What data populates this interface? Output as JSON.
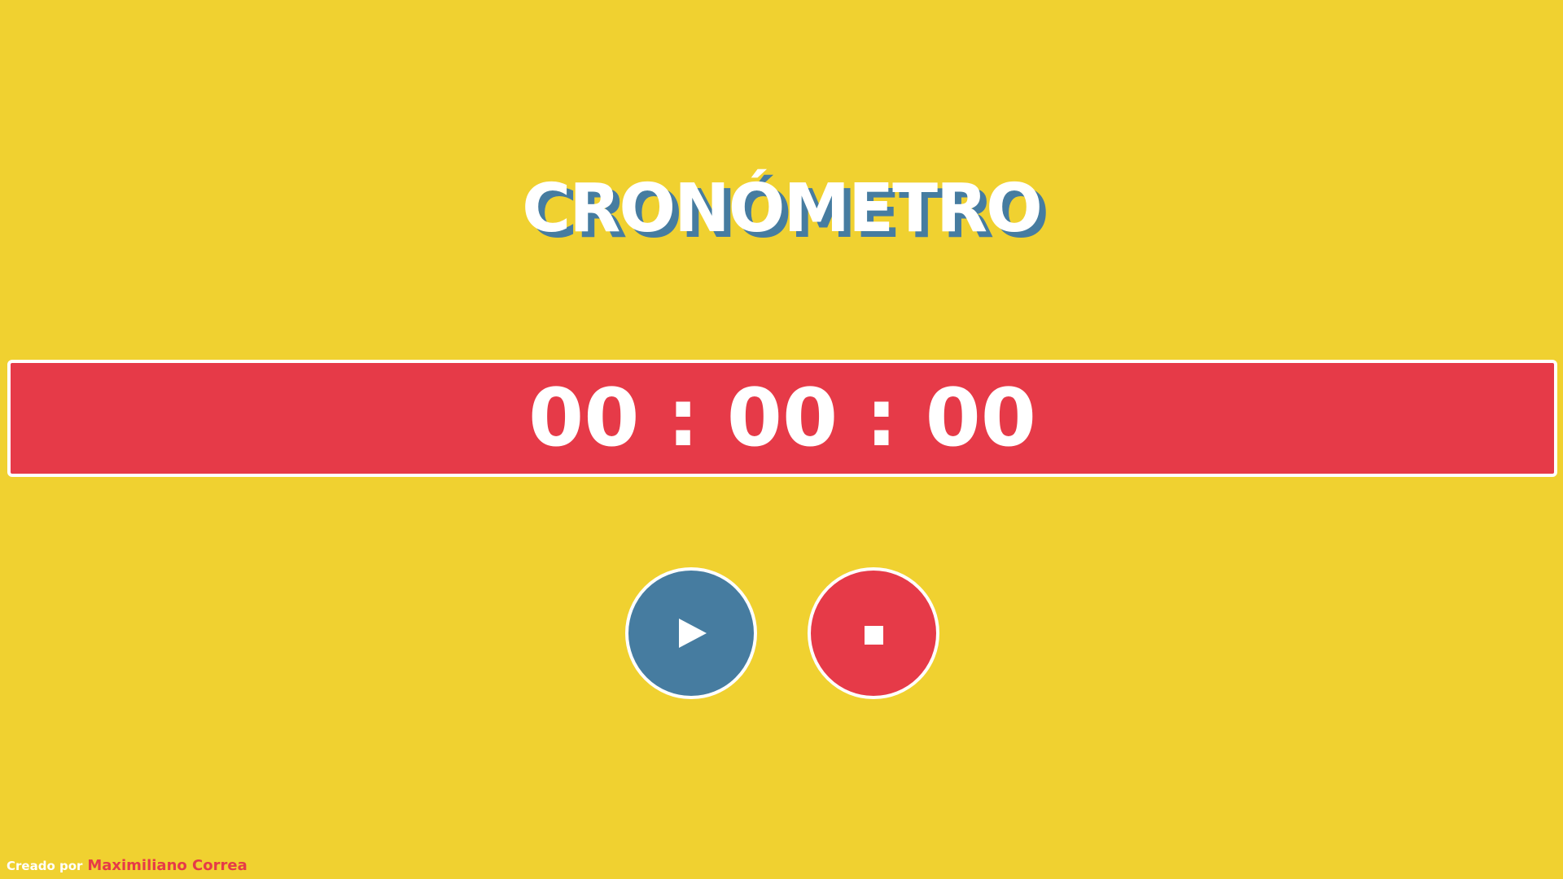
{
  "app": {
    "title": "CRONÓMETRO"
  },
  "timer": {
    "display": "00 : 00 : 00"
  },
  "controls": {
    "start": {
      "icon": "play-icon"
    },
    "stop": {
      "icon": "stop-icon"
    }
  },
  "footer": {
    "prefix": "Creado por",
    "author": "Maximiliano Correa"
  },
  "colors": {
    "background": "#F0D130",
    "accent_red": "#E63A48",
    "accent_blue": "#467CA0",
    "white": "#FFFFFF"
  }
}
